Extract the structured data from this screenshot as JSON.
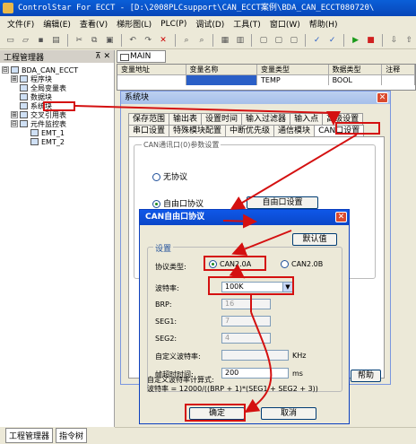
{
  "window": {
    "title": "ControlStar For ECCT - [D:\\2008PLCsupport\\CAN_ECCT案例\\BDA_CAN_ECCT080720\\"
  },
  "menu": [
    "文件(F)",
    "编辑(E)",
    "查看(V)",
    "梯形图(L)",
    "PLC(P)",
    "调试(D)",
    "工具(T)",
    "窗口(W)",
    "帮助(H)"
  ],
  "left_panel": {
    "title": "工程管理器",
    "pin": "⊼ ✕",
    "tree": [
      {
        "label": "BDA_CAN_ECCT",
        "indent": 0,
        "expander": "⊟"
      },
      {
        "label": "程序块",
        "indent": 1,
        "expander": "⊞"
      },
      {
        "label": "全局变量表",
        "indent": 1,
        "expander": ""
      },
      {
        "label": "数据块",
        "indent": 1,
        "expander": ""
      },
      {
        "label": "系统块",
        "indent": 1,
        "expander": ""
      },
      {
        "label": "交叉引用表",
        "indent": 1,
        "expander": "⊞"
      },
      {
        "label": "元件监控表",
        "indent": 1,
        "expander": "⊟"
      },
      {
        "label": "EMT_1",
        "indent": 2,
        "expander": ""
      },
      {
        "label": "EMT_2",
        "indent": 2,
        "expander": ""
      }
    ],
    "tabs": [
      "工程管理器",
      "指令树"
    ]
  },
  "main_tab": "MAIN",
  "var_table": {
    "headers": [
      "变量地址",
      "变量名称",
      "变量类型",
      "数据类型",
      "注释"
    ],
    "row": [
      "",
      "",
      "TEMP",
      "BOOL",
      ""
    ]
  },
  "system_dialog": {
    "title": "系统块",
    "tabs_row1": [
      "保存范围",
      "输出表",
      "设置时间",
      "输入过滤器",
      "输入点",
      "高级设置"
    ],
    "tabs_row2": [
      "串口设置",
      "特殊模块配置",
      "中断优先级",
      "通信模块",
      "CAN口设置"
    ],
    "group_label": "CAN通讯口(0)参数设置",
    "radio_none": "无协议",
    "radio_free": "自由口协议",
    "free_btn": "自由口设置",
    "help_btn": "帮助"
  },
  "can_dialog": {
    "title": "CAN自由口协议",
    "default_btn": "默认值",
    "group_label": "设置",
    "protocol_label": "协议类型:",
    "opt_a": "CAN2.0A",
    "opt_b": "CAN2.0B",
    "baud_label": "波特率:",
    "baud_value": "100K",
    "brp_label": "BRP:",
    "brp_value": "16",
    "seg1_label": "SEG1:",
    "seg1_value": "7",
    "seg2_label": "SEG2:",
    "seg2_value": "4",
    "custom_label": "自定义波特率:",
    "custom_value": "",
    "custom_unit": "KHz",
    "frame_label": "帧超时时间:",
    "frame_value": "200",
    "frame_unit": "ms",
    "formula_line1": "自定义波特率计算式:",
    "formula_line2": "波特率 = 12000/((BRP + 1)*(SEG1 + SEG2 + 3))",
    "ok": "确定",
    "cancel": "取消"
  },
  "colors": {
    "title_blue": "#0a46c8",
    "highlight_red": "#d41010",
    "face": "#ece9d8"
  }
}
